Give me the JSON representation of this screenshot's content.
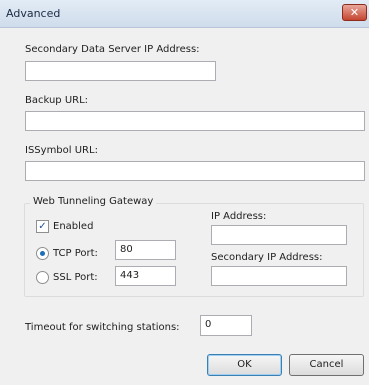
{
  "window": {
    "title": "Advanced",
    "close_label": "✕"
  },
  "secondary_server": {
    "label": "Secondary Data Server IP Address:",
    "value": ""
  },
  "backup_url": {
    "label": "Backup URL:",
    "value": ""
  },
  "issymbol_url": {
    "label": "ISSymbol URL:",
    "value": ""
  },
  "tunneling": {
    "group_title": "Web Tunneling Gateway",
    "enabled_label": "Enabled",
    "enabled_checked": true,
    "tcp_port_label": "TCP Port:",
    "tcp_port_value": "80",
    "tcp_selected": true,
    "ssl_port_label": "SSL Port:",
    "ssl_port_value": "443",
    "ip_label": "IP Address:",
    "ip_value": "",
    "secondary_ip_label": "Secondary IP Address:",
    "secondary_ip_value": ""
  },
  "timeout": {
    "label": "Timeout for switching stations:",
    "value": "0"
  },
  "buttons": {
    "ok": "OK",
    "cancel": "Cancel"
  },
  "icons": {
    "checkmark": "✓"
  },
  "colors": {
    "close_button": "#c4452f",
    "accent": "#1d6fb8"
  }
}
